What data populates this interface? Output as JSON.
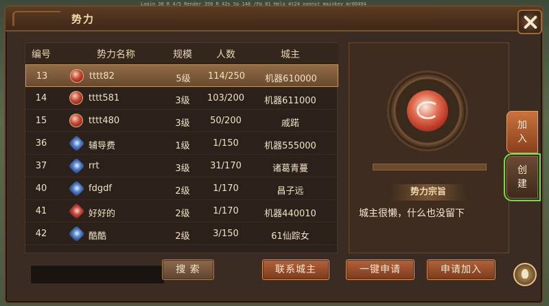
{
  "debug_overlay": "Login 30 R 4/5  Render 350 R 42s  Sp 148 /Fp 81 Helo 4t24 oonnst mainkey mr00494",
  "window": {
    "title": "势力",
    "close_icon": "close-icon"
  },
  "table": {
    "columns": [
      "编号",
      "势力名称",
      "规模",
      "人数",
      "城主"
    ],
    "rows": [
      {
        "id": "13",
        "icon": "red-seal",
        "name": "tttt82",
        "level": "5级",
        "members": "114/250",
        "lord": "机器610000",
        "selected": true
      },
      {
        "id": "14",
        "icon": "red-seal",
        "name": "tttt581",
        "level": "3级",
        "members": "103/200",
        "lord": "机器611000",
        "selected": false
      },
      {
        "id": "15",
        "icon": "red-seal",
        "name": "tttt480",
        "level": "3级",
        "members": "50/200",
        "lord": "戚蹃",
        "selected": false
      },
      {
        "id": "36",
        "icon": "blue-emblem",
        "name": "辅导费",
        "level": "1级",
        "members": "1/150",
        "lord": "机器555000",
        "selected": false
      },
      {
        "id": "37",
        "icon": "blue-emblem",
        "name": "rrt",
        "level": "3级",
        "members": "31/170",
        "lord": "诸葛青蔓",
        "selected": false
      },
      {
        "id": "40",
        "icon": "blue-emblem",
        "name": "fdgdf",
        "level": "2级",
        "members": "1/170",
        "lord": "昌子远",
        "selected": false
      },
      {
        "id": "41",
        "icon": "red-emblem",
        "name": "好好的",
        "level": "2级",
        "members": "1/170",
        "lord": "机器440010",
        "selected": false
      },
      {
        "id": "42",
        "icon": "blue-emblem",
        "name": "酷酷",
        "level": "2级",
        "members": "3/150",
        "lord": "61仙踪女",
        "selected": false
      }
    ]
  },
  "search": {
    "placeholder": "",
    "button": "搜 索"
  },
  "actions": {
    "contact_lord": "联系城主",
    "one_click_apply": "一键申请",
    "apply_join": "申请加入"
  },
  "detail": {
    "emblem_icon": "faction-beast-emblem",
    "purpose_title": "势力宗旨",
    "purpose_text": "城主很懒，什么也没留下"
  },
  "side": {
    "join": "加入",
    "create": "创建"
  },
  "colors": {
    "accent": "#b5633a",
    "highlight_outline": "#6fe23a",
    "selected_row": "#8f6a45"
  }
}
